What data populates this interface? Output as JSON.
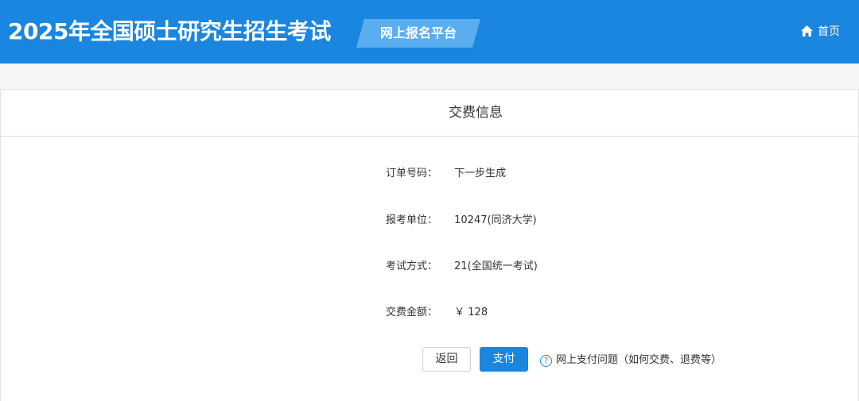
{
  "header": {
    "title": "2025年全国硕士研究生招生考试",
    "platform_badge": "网上报名平台",
    "home_label": "首页",
    "home_icon": "home-icon",
    "background_color": "#1a86df"
  },
  "panel": {
    "title": "交费信息",
    "fields": [
      {
        "label": "订单号码：",
        "value": "下一步生成"
      },
      {
        "label": "报考单位：",
        "value": "10247(同济大学)"
      },
      {
        "label": "考试方式：",
        "value": "21(全国统一考试)"
      },
      {
        "label": "交费金额：",
        "value": "￥ 128"
      }
    ]
  },
  "actions": {
    "back_label": "返回",
    "pay_label": "支付",
    "help_icon": "question-circle-icon",
    "help_label": "网上支付问题（如何交费、退费等）",
    "accent_color": "#1a86df"
  }
}
